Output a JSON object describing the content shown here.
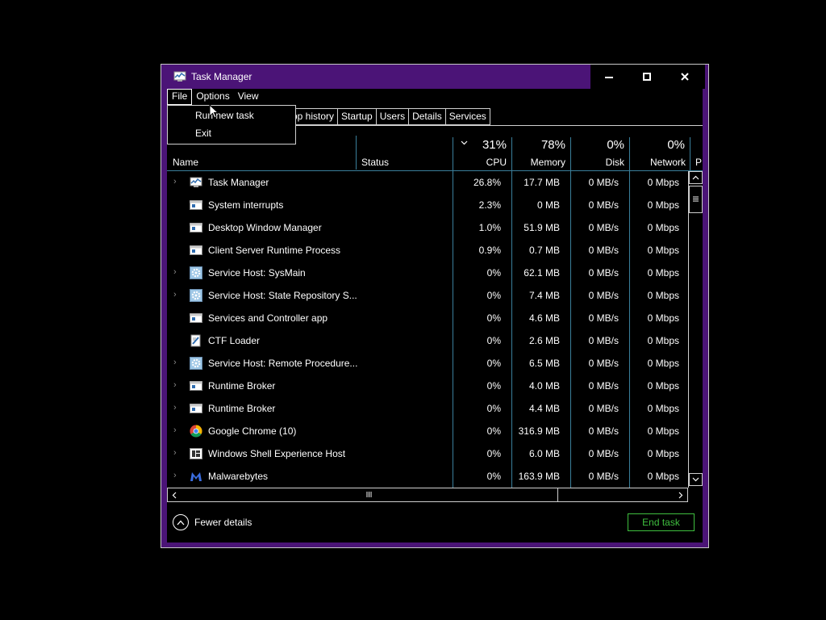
{
  "window": {
    "title": "Task Manager",
    "accent_color": "#4b1477"
  },
  "controls": {
    "minimize_icon": "minimize-icon",
    "maximize_icon": "maximize-icon",
    "close_icon": "close-icon"
  },
  "menu": {
    "file": "File",
    "options": "Options",
    "view": "View"
  },
  "file_menu": {
    "run_new_task": "Run new task",
    "exit": "Exit"
  },
  "tabs": [
    "App history",
    "Startup",
    "Users",
    "Details",
    "Services"
  ],
  "tab_visible_text": {
    "app_history": "pp history"
  },
  "columns": {
    "name": "Name",
    "status": "Status",
    "cpu": {
      "pct": "31%",
      "label": "CPU"
    },
    "memory": {
      "pct": "78%",
      "label": "Memory"
    },
    "disk": {
      "pct": "0%",
      "label": "Disk"
    },
    "network": {
      "pct": "0%",
      "label": "Network"
    },
    "power_partial": "P"
  },
  "processes": [
    {
      "name": "Task Manager",
      "cpu": "26.8%",
      "memory": "17.7 MB",
      "disk": "0 MB/s",
      "network": "0 Mbps",
      "icon": "task-manager-icon",
      "expandable": true
    },
    {
      "name": "System interrupts",
      "cpu": "2.3%",
      "memory": "0 MB",
      "disk": "0 MB/s",
      "network": "0 Mbps",
      "icon": "app-window-icon",
      "expandable": false
    },
    {
      "name": "Desktop Window Manager",
      "cpu": "1.0%",
      "memory": "51.9 MB",
      "disk": "0 MB/s",
      "network": "0 Mbps",
      "icon": "app-window-icon",
      "expandable": false
    },
    {
      "name": "Client Server Runtime Process",
      "cpu": "0.9%",
      "memory": "0.7 MB",
      "disk": "0 MB/s",
      "network": "0 Mbps",
      "icon": "app-window-icon",
      "expandable": false
    },
    {
      "name": "Service Host: SysMain",
      "cpu": "0%",
      "memory": "62.1 MB",
      "disk": "0 MB/s",
      "network": "0 Mbps",
      "icon": "gear-icon",
      "expandable": true
    },
    {
      "name": "Service Host: State Repository S...",
      "cpu": "0%",
      "memory": "7.4 MB",
      "disk": "0 MB/s",
      "network": "0 Mbps",
      "icon": "gear-icon",
      "expandable": true
    },
    {
      "name": "Services and Controller app",
      "cpu": "0%",
      "memory": "4.6 MB",
      "disk": "0 MB/s",
      "network": "0 Mbps",
      "icon": "app-window-icon",
      "expandable": false
    },
    {
      "name": "CTF Loader",
      "cpu": "0%",
      "memory": "2.6 MB",
      "disk": "0 MB/s",
      "network": "0 Mbps",
      "icon": "pen-document-icon",
      "expandable": false
    },
    {
      "name": "Service Host: Remote Procedure...",
      "cpu": "0%",
      "memory": "6.5 MB",
      "disk": "0 MB/s",
      "network": "0 Mbps",
      "icon": "gear-icon",
      "expandable": true
    },
    {
      "name": "Runtime Broker",
      "cpu": "0%",
      "memory": "4.0 MB",
      "disk": "0 MB/s",
      "network": "0 Mbps",
      "icon": "app-window-icon",
      "expandable": true
    },
    {
      "name": "Runtime Broker",
      "cpu": "0%",
      "memory": "4.4 MB",
      "disk": "0 MB/s",
      "network": "0 Mbps",
      "icon": "app-window-icon",
      "expandable": true
    },
    {
      "name": "Google Chrome (10)",
      "cpu": "0%",
      "memory": "316.9 MB",
      "disk": "0 MB/s",
      "network": "0 Mbps",
      "icon": "chrome-icon",
      "expandable": true
    },
    {
      "name": "Windows Shell Experience Host",
      "cpu": "0%",
      "memory": "6.0 MB",
      "disk": "0 MB/s",
      "network": "0 Mbps",
      "icon": "shell-window-icon",
      "expandable": true
    },
    {
      "name": "Malwarebytes",
      "cpu": "0%",
      "memory": "163.9 MB",
      "disk": "0 MB/s",
      "network": "0 Mbps",
      "icon": "malwarebytes-icon",
      "expandable": true
    }
  ],
  "footer": {
    "fewer_details": "Fewer details",
    "end_task": "End task",
    "end_task_color": "#3fbf3f"
  }
}
